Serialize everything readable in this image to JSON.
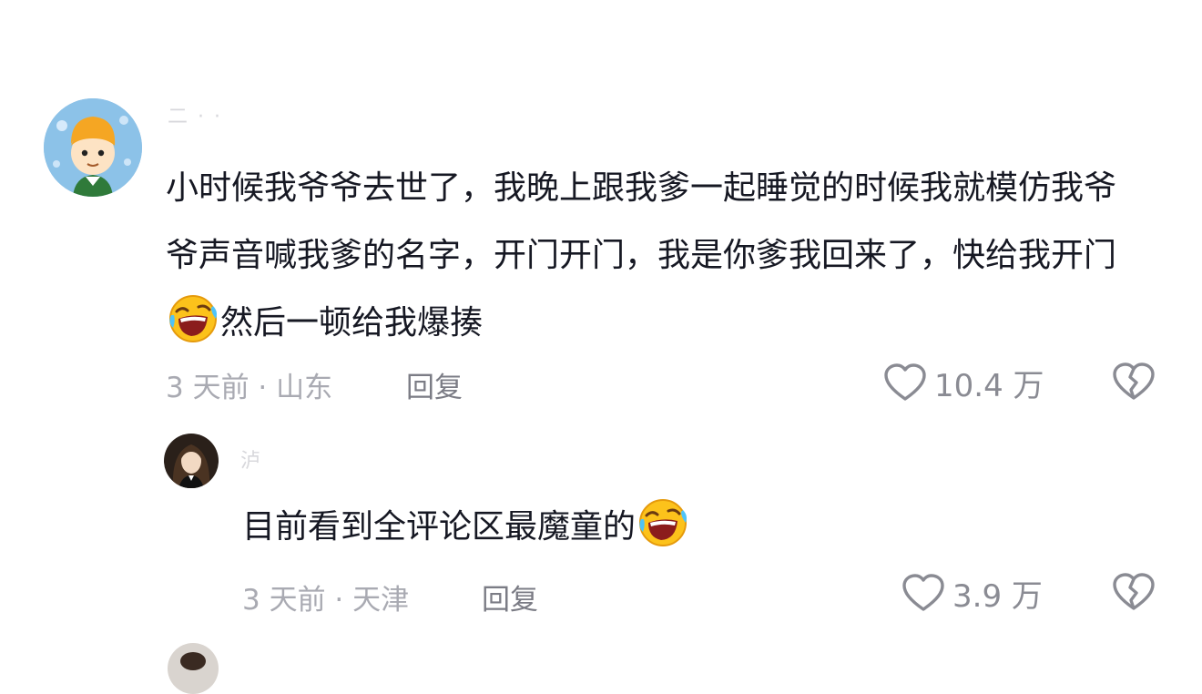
{
  "comments": [
    {
      "username": "二 · ·",
      "text_before_emoji": "小时候我爷爷去世了，我晚上跟我爹一起睡觉的时候我就模仿我爷爷声音喊我爹的名字，开门开门，我是你爹我回来了，快给我开门",
      "emoji": "rolling-on-floor-laughing",
      "text_after_emoji": "然后一顿给我爆揍",
      "meta": "3 天前 · 山东",
      "reply_label": "回复",
      "like_count": "10.4 万"
    },
    {
      "username": "泸",
      "text_before_emoji": "目前看到全评论区最魔童的",
      "emoji": "rolling-on-floor-laughing",
      "text_after_emoji": "",
      "meta": "3 天前 · 天津",
      "reply_label": "回复",
      "like_count": "3.9 万"
    }
  ],
  "colors": {
    "text": "#161823",
    "meta": "#a9aab2",
    "reply": "#7b7c85",
    "icon": "#8a8b93",
    "background": "#ffffff"
  }
}
